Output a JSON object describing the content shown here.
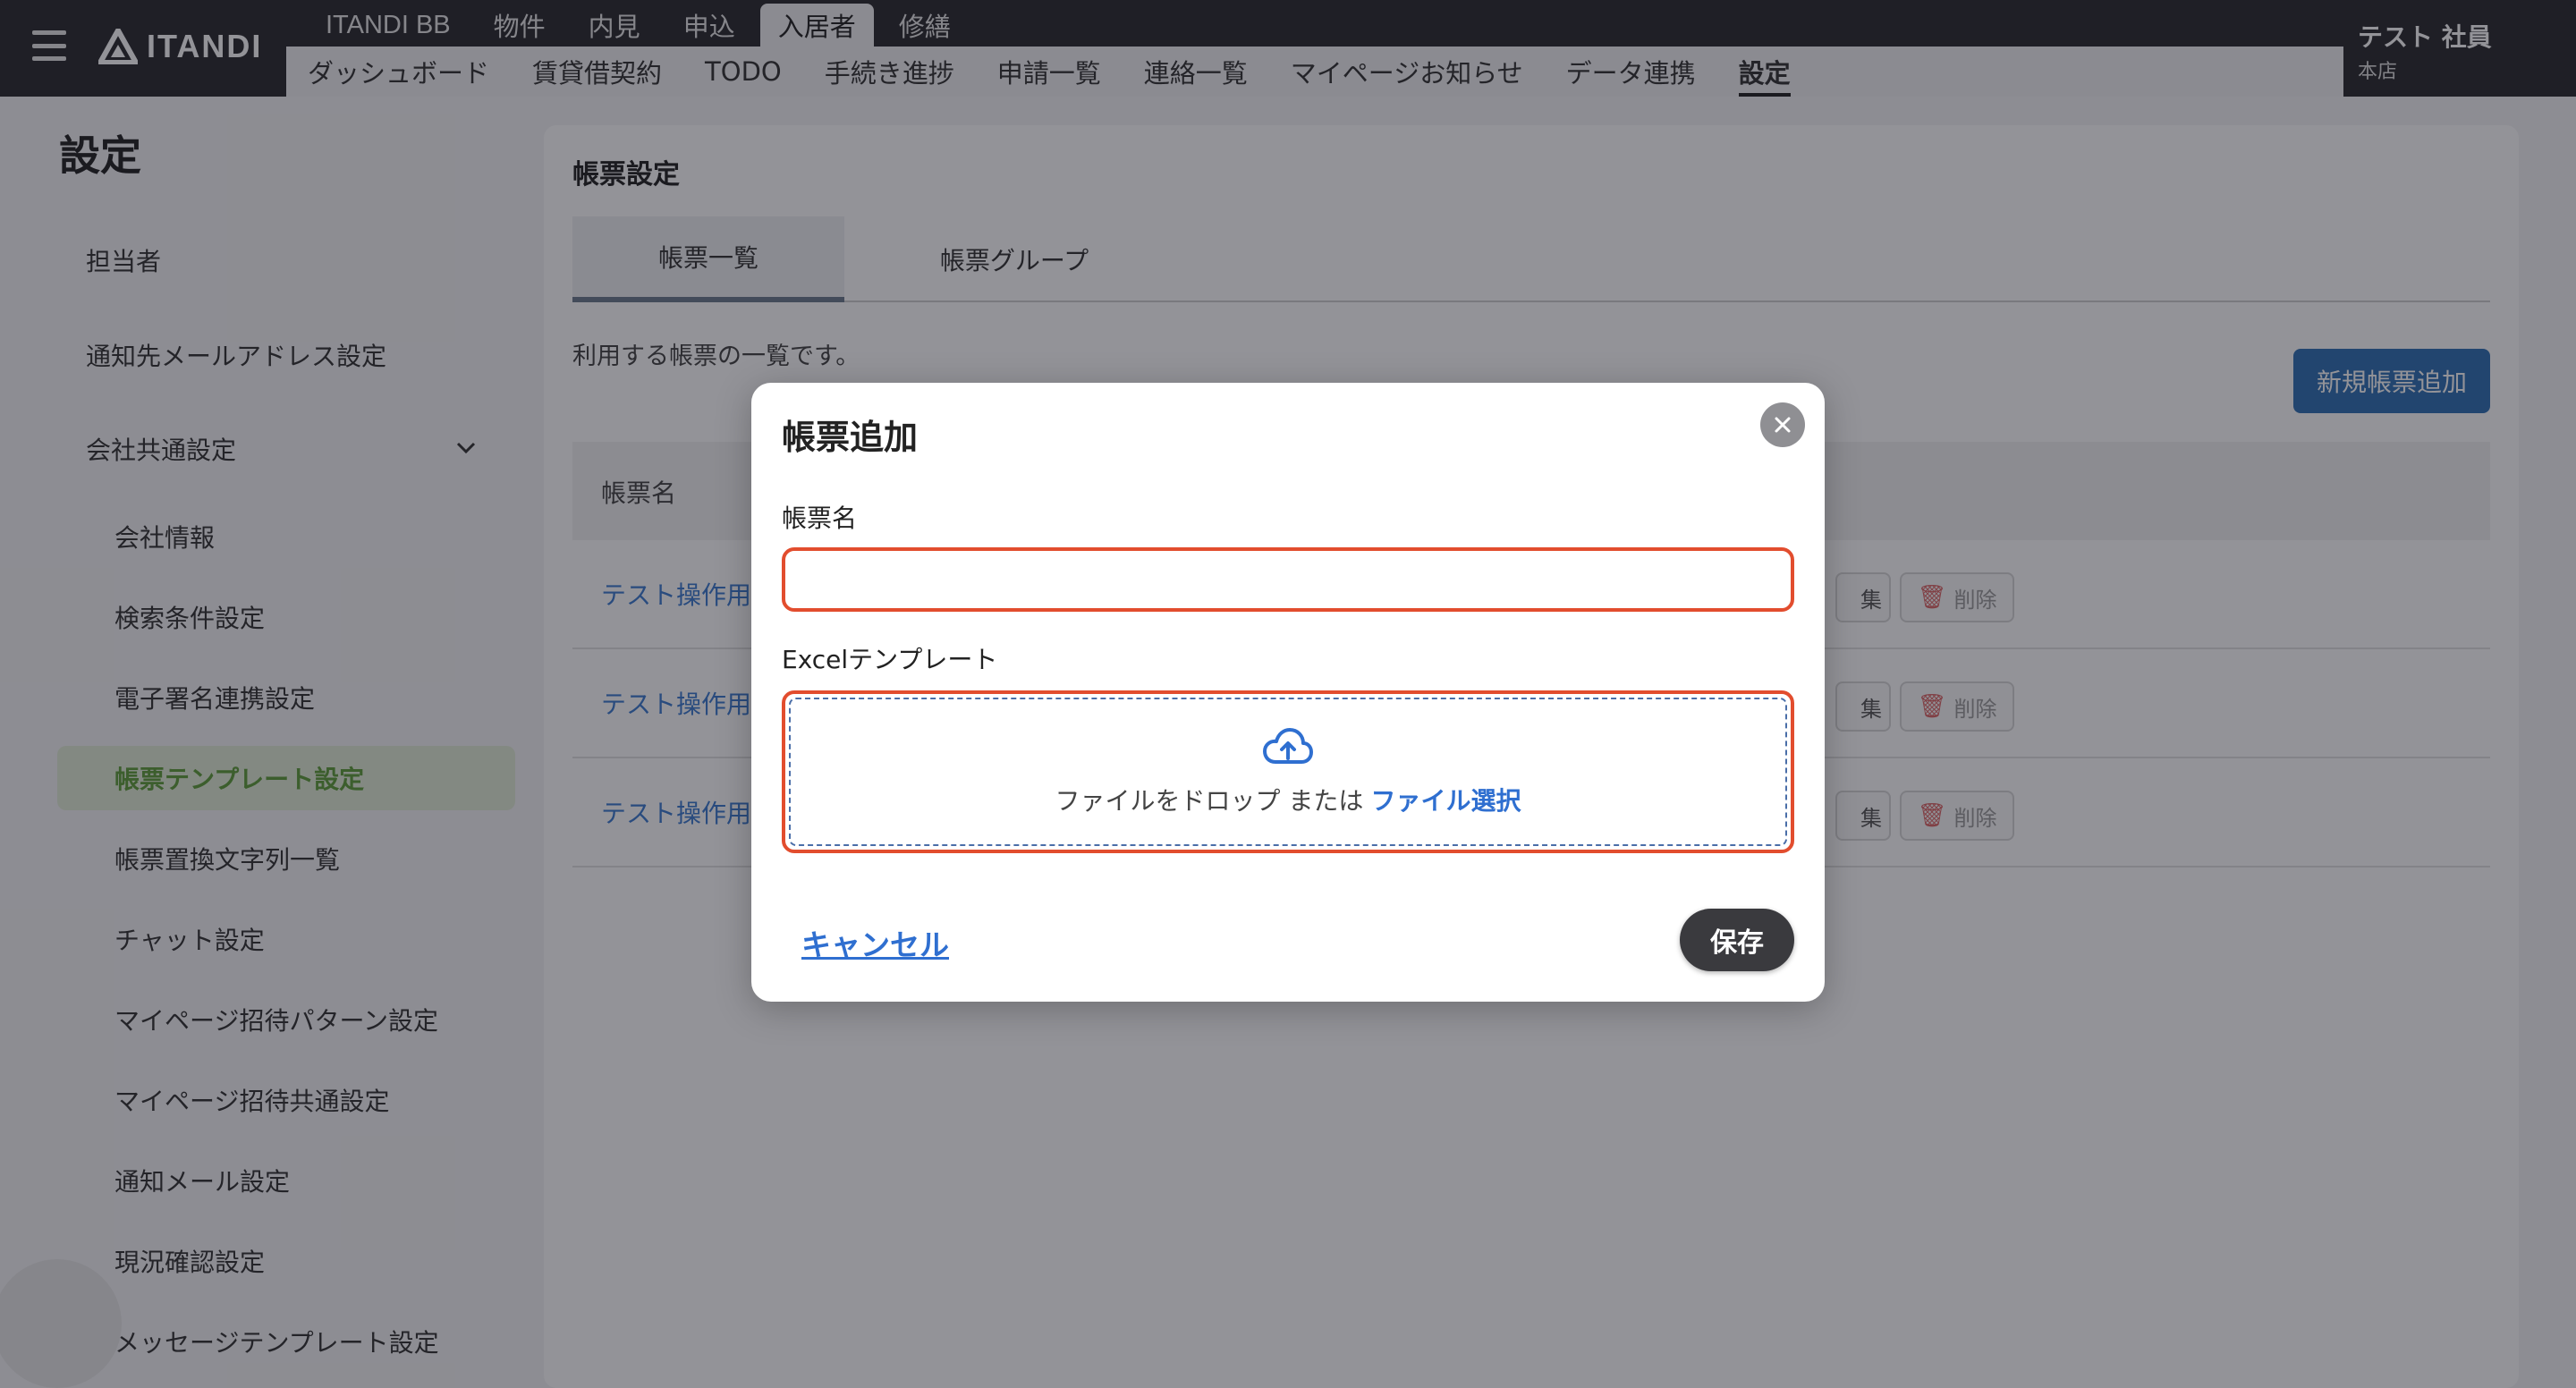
{
  "header": {
    "logo_text": "ITANDI",
    "nav_tabs": [
      {
        "label": "ITANDI BB",
        "active": false
      },
      {
        "label": "物件",
        "active": false
      },
      {
        "label": "内見",
        "active": false
      },
      {
        "label": "申込",
        "active": false
      },
      {
        "label": "入居者",
        "active": true
      },
      {
        "label": "修繕",
        "active": false
      }
    ],
    "sub_nav": [
      {
        "label": "ダッシュボード",
        "active": false
      },
      {
        "label": "賃貸借契約",
        "active": false
      },
      {
        "label": "TODO",
        "active": false
      },
      {
        "label": "手続き進捗",
        "active": false
      },
      {
        "label": "申請一覧",
        "active": false
      },
      {
        "label": "連絡一覧",
        "active": false
      },
      {
        "label": "マイページお知らせ",
        "active": false
      },
      {
        "label": "データ連携",
        "active": false
      },
      {
        "label": "設定",
        "active": true
      }
    ],
    "user": {
      "name": "テスト 社員",
      "store": "本店"
    }
  },
  "sidebar": {
    "title": "設定",
    "items": [
      {
        "label": "担当者",
        "level": 1
      },
      {
        "label": "通知先メールアドレス設定",
        "level": 1
      },
      {
        "label": "会社共通設定",
        "level": 1,
        "expanded": true
      },
      {
        "label": "会社情報",
        "level": 2
      },
      {
        "label": "検索条件設定",
        "level": 2
      },
      {
        "label": "電子署名連携設定",
        "level": 2
      },
      {
        "label": "帳票テンプレート設定",
        "level": 2,
        "active": true
      },
      {
        "label": "帳票置換文字列一覧",
        "level": 2
      },
      {
        "label": "チャット設定",
        "level": 2
      },
      {
        "label": "マイページ招待パターン設定",
        "level": 2
      },
      {
        "label": "マイページ招待共通設定",
        "level": 2
      },
      {
        "label": "通知メール設定",
        "level": 2
      },
      {
        "label": "現況確認設定",
        "level": 2
      },
      {
        "label": "メッセージテンプレート設定",
        "level": 2
      }
    ]
  },
  "main": {
    "title": "帳票設定",
    "tabs": [
      {
        "label": "帳票一覧",
        "active": true
      },
      {
        "label": "帳票グループ",
        "active": false
      }
    ],
    "description": "利用する帳票の一覧です。",
    "add_button": "新規帳票追加",
    "table": {
      "header": "帳票名",
      "rows": [
        {
          "name": "テスト操作用",
          "edit": "集",
          "delete": "削除"
        },
        {
          "name": "テスト操作用",
          "edit": "集",
          "delete": "削除"
        },
        {
          "name": "テスト操作用",
          "edit": "集",
          "delete": "削除"
        }
      ]
    }
  },
  "modal": {
    "title": "帳票追加",
    "name_label": "帳票名",
    "name_value": "",
    "name_placeholder": "",
    "template_label": "Excelテンプレート",
    "drop_text": "ファイルをドロップ または",
    "drop_link": "ファイル選択",
    "cancel": "キャンセル",
    "save": "保存"
  },
  "colors": {
    "accent": "#2f6fd0",
    "error_border": "#e24d2e",
    "header_bg": "#2a2a2e",
    "active_sidebar": "#5e9e3a"
  }
}
